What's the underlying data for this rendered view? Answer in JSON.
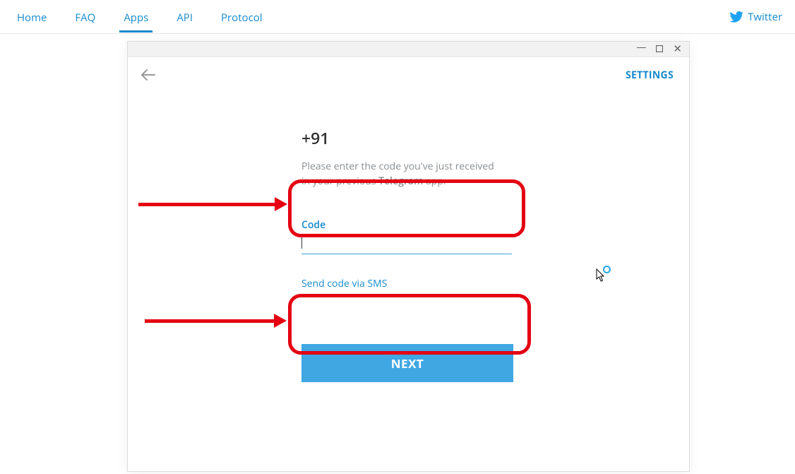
{
  "nav": {
    "home": "Home",
    "faq": "FAQ",
    "apps": "Apps",
    "api": "API",
    "protocol": "Protocol",
    "twitter": "Twitter"
  },
  "window": {
    "settings": "SETTINGS",
    "phone": "+91",
    "instruction_line1": "Please enter the code you've just received",
    "instruction_line2_prefix": "in your previous ",
    "instruction_line2_bold": "Telegram",
    "instruction_line2_suffix": " app.",
    "code_label": "Code",
    "code_value": "",
    "sms_link": "Send code via SMS",
    "next_button": "NEXT"
  }
}
